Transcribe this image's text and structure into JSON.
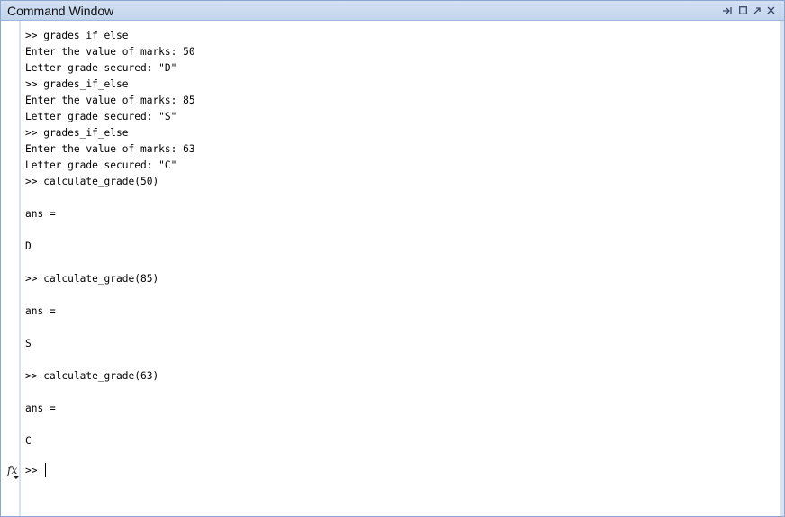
{
  "window": {
    "title": "Command Window"
  },
  "controls": {
    "undock_icon": "undock-icon",
    "maximize_icon": "maximize-icon",
    "popout_icon": "popout-icon",
    "close_icon": "close-icon"
  },
  "console": {
    "lines": [
      ">> grades_if_else",
      "Enter the value of marks: 50",
      "Letter grade secured: \"D\"",
      ">> grades_if_else",
      "Enter the value of marks: 85",
      "Letter grade secured: \"S\"",
      ">> grades_if_else",
      "Enter the value of marks: 63",
      "Letter grade secured: \"C\"",
      ">> calculate_grade(50)",
      "",
      "ans =",
      "",
      "D",
      "",
      ">> calculate_grade(85)",
      "",
      "ans =",
      "",
      "S",
      "",
      ">> calculate_grade(63)",
      "",
      "ans =",
      "",
      "C"
    ],
    "prompt": ">>",
    "input_value": ""
  },
  "fx": {
    "label": "fx"
  }
}
